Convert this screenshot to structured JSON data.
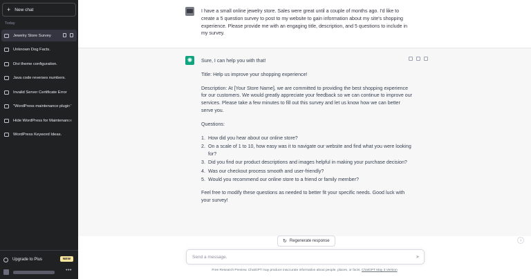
{
  "sidebar": {
    "new_chat": "New chat",
    "section": "Today",
    "items": [
      {
        "label": "Jewelry Store Survey"
      },
      {
        "label": "Unknown Dog Facts."
      },
      {
        "label": "Divi theme configuration."
      },
      {
        "label": "Java code reverses numbers."
      },
      {
        "label": "Invalid Server Certificate Error"
      },
      {
        "label": "\"WordPress maintenance plugin\""
      },
      {
        "label": "Hide WordPress for Maintenance"
      },
      {
        "label": "WordPress Keyword Ideas."
      }
    ],
    "upgrade": "Upgrade to Plus",
    "badge": "NEW"
  },
  "conversation": {
    "user_message": "I have a small online jewelry store. Sales were great until a couple of months ago. I'd like to create a 5 question survey to post to my website to gain information about my site's shopping experience. Please provide me with an engaging title, description, and 5 questions to include in my survey.",
    "assistant": {
      "intro": "Sure, I can help you with that!",
      "title": "Title: Help us improve your shopping experience!",
      "description": "Description: At [Your Store Name], we are committed to providing the best shopping experience for our customers. We would greatly appreciate your feedback so we can continue to improve our services. Please take a few minutes to fill out this survey and let us know how we can better serve you.",
      "questions_heading": "Questions:",
      "questions": [
        {
          "num": "1.",
          "text": "How did you hear about our online store?"
        },
        {
          "num": "2.",
          "text": "On a scale of 1 to 10, how easy was it to navigate our website and find what you were looking for?"
        },
        {
          "num": "3.",
          "text": "Did you find our product descriptions and images helpful in making your purchase decision?"
        },
        {
          "num": "4.",
          "text": "Was our checkout process smooth and user-friendly?"
        },
        {
          "num": "5.",
          "text": "Would you recommend our online store to a friend or family member?"
        }
      ],
      "closing": "Feel free to modify these questions as needed to better fit your specific needs. Good luck with your survey!"
    }
  },
  "composer": {
    "regenerate": "Regenerate response",
    "placeholder": "Send a message."
  },
  "footer": {
    "text": "Free Research Preview. ChatGPT may produce inaccurate information about people, places, or facts.",
    "link": "ChatGPT May 3 Version"
  },
  "colors": {
    "sidebar_bg": "#202123",
    "accent": "#10a37f",
    "badge": "#fae69e"
  }
}
